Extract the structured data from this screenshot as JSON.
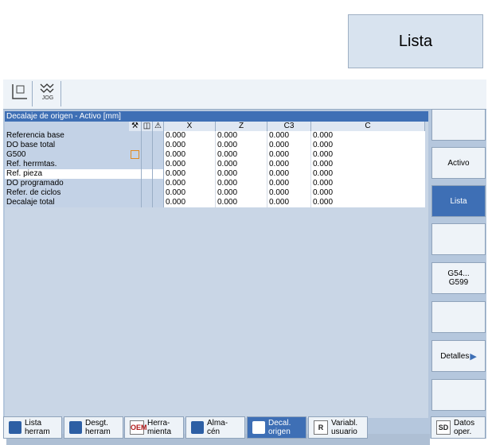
{
  "top_button": {
    "label": "Lista"
  },
  "header": {
    "icon1": "coordinate-icon",
    "icon2": "jog-icon",
    "jog": "JOG"
  },
  "panel": {
    "title": "Decalaje de origen  -  Activo   [mm]"
  },
  "table": {
    "columns": [
      "",
      "X",
      "Z",
      "C3",
      "C"
    ],
    "flag_icons": [
      "wrench-icon",
      "frame-icon",
      "warning-icon"
    ],
    "rows": [
      {
        "label": "Referencia base",
        "x": "0.000",
        "z": "0.000",
        "c3": "0.000",
        "c": "0.000"
      },
      {
        "label": "DO base total",
        "x": "0.000",
        "z": "0.000",
        "c3": "0.000",
        "c": "0.000"
      },
      {
        "label": "G500",
        "x": "0.000",
        "z": "0.000",
        "c3": "0.000",
        "c": "0.000"
      },
      {
        "label": "Ref. herrmtas.",
        "x": "0.000",
        "z": "0.000",
        "c3": "0.000",
        "c": "0.000"
      },
      {
        "label": "Ref. pieza",
        "x": "0.000",
        "z": "0.000",
        "c3": "0.000",
        "c": "0.000"
      },
      {
        "label": "DO programado",
        "x": "0.000",
        "z": "0.000",
        "c3": "0.000",
        "c": "0.000"
      },
      {
        "label": "Refer. de ciclos",
        "x": "0.000",
        "z": "0.000",
        "c3": "0.000",
        "c": "0.000"
      },
      {
        "label": "Decalaje total",
        "x": "0.000",
        "z": "0.000",
        "c3": "0.000",
        "c": "0.000"
      }
    ]
  },
  "vertical_softkeys": [
    "",
    "Activo",
    "Lista",
    "",
    "G54...\nG599",
    "",
    "Detalles",
    ""
  ],
  "horizontal_softkeys": [
    {
      "l1": "Lista",
      "l2": "herram"
    },
    {
      "l1": "Desgt.",
      "l2": "herram"
    },
    {
      "l1": "Herra-",
      "l2": "mienta",
      "icon_text": "OEM"
    },
    {
      "l1": "Alma-",
      "l2": "cén"
    },
    {
      "l1": "Decal.",
      "l2": "origen"
    },
    {
      "l1": "Variabl.",
      "l2": "usuario",
      "icon_text": "R"
    },
    {
      "l1": "Datos",
      "l2": "oper.",
      "icon_text": "SD"
    }
  ],
  "colors": {
    "accent": "#3e6fb5",
    "panel": "#c9d6e6",
    "g500_marker": "#e08a20"
  }
}
